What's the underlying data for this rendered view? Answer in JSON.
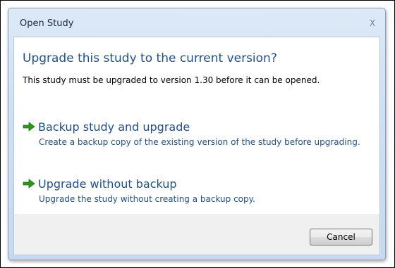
{
  "window": {
    "title": "Open Study",
    "close_glyph": "X"
  },
  "main": {
    "heading": "Upgrade this study to the current version?",
    "description": "This study must be upgraded to version 1.30 before it can be opened."
  },
  "options": [
    {
      "icon": "green-arrow-icon",
      "title": "Backup study and upgrade",
      "description": "Create a backup copy of the existing version of the study before upgrading."
    },
    {
      "icon": "green-arrow-icon",
      "title": "Upgrade without backup",
      "description": "Upgrade the study without creating a backup copy."
    }
  ],
  "footer": {
    "cancel_label": "Cancel"
  },
  "colors": {
    "accent_text": "#1a4f9c",
    "arrow_green": "#2a9a18",
    "title_gradient_top": "#dde9f7",
    "title_gradient_bottom": "#c6d9f0"
  }
}
